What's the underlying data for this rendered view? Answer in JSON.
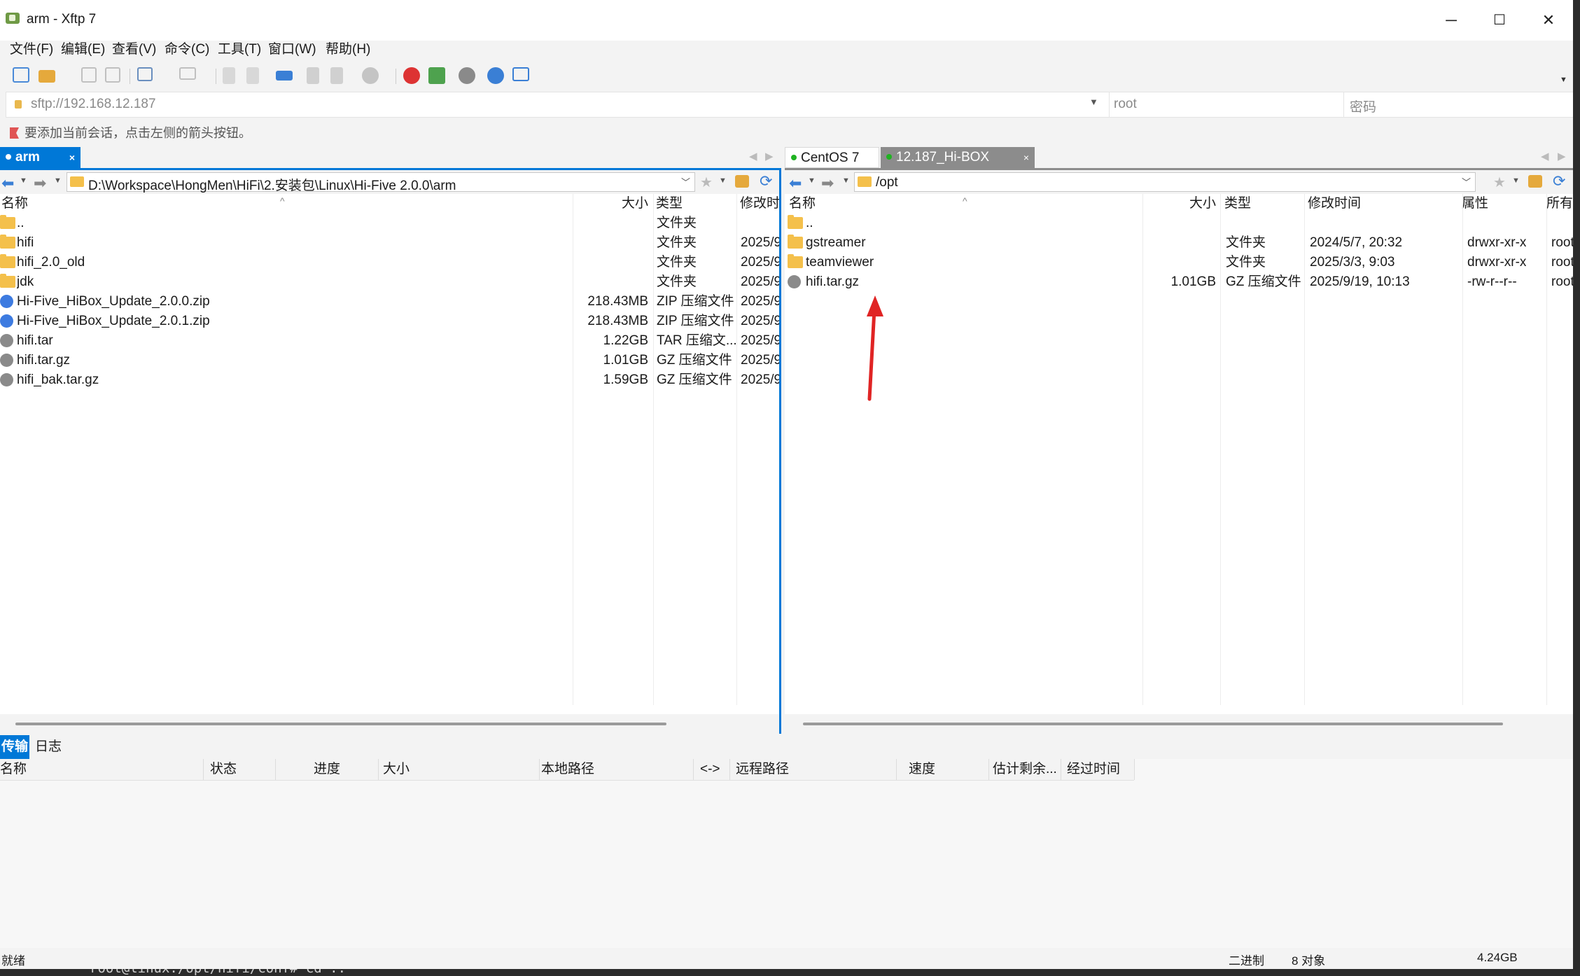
{
  "window": {
    "title": "arm - Xftp 7",
    "minimize": "─",
    "maximize": "☐",
    "close": "✕"
  },
  "menu": [
    "文件(F)",
    "编辑(E)",
    "查看(V)",
    "命令(C)",
    "工具(T)",
    "窗口(W)",
    "帮助(H)"
  ],
  "address": {
    "url": "sftp://192.168.12.187",
    "user_placeholder": "root",
    "password_placeholder": "密码"
  },
  "hint": "要添加当前会话，点击左侧的箭头按钮。",
  "left": {
    "tab": "arm",
    "path": "D:\\Workspace\\HongMen\\HiFi\\2.安装包\\Linux\\Hi-Five 2.0.0\\arm",
    "columns": [
      "名称",
      "大小",
      "类型",
      "修改时"
    ],
    "rows": [
      {
        "name": "..",
        "size": "",
        "type": "文件夹",
        "mtime": ""
      },
      {
        "name": "hifi",
        "size": "",
        "type": "文件夹",
        "mtime": "2025/9"
      },
      {
        "name": "hifi_2.0_old",
        "size": "",
        "type": "文件夹",
        "mtime": "2025/9"
      },
      {
        "name": "jdk",
        "size": "",
        "type": "文件夹",
        "mtime": "2025/9"
      },
      {
        "name": "Hi-Five_HiBox_Update_2.0.0.zip",
        "size": "218.43MB",
        "type": "ZIP 压缩文件",
        "mtime": "2025/9"
      },
      {
        "name": "Hi-Five_HiBox_Update_2.0.1.zip",
        "size": "218.43MB",
        "type": "ZIP 压缩文件",
        "mtime": "2025/9"
      },
      {
        "name": "hifi.tar",
        "size": "1.22GB",
        "type": "TAR 压缩文...",
        "mtime": "2025/9"
      },
      {
        "name": "hifi.tar.gz",
        "size": "1.01GB",
        "type": "GZ 压缩文件",
        "mtime": "2025/9"
      },
      {
        "name": "hifi_bak.tar.gz",
        "size": "1.59GB",
        "type": "GZ 压缩文件",
        "mtime": "2025/9"
      }
    ]
  },
  "right": {
    "tabs": [
      "CentOS 7",
      "12.187_Hi-BOX"
    ],
    "path": "/opt",
    "columns": [
      "名称",
      "大小",
      "类型",
      "修改时间",
      "属性",
      "所有"
    ],
    "rows": [
      {
        "name": "..",
        "size": "",
        "type": "",
        "mtime": "",
        "attr": "",
        "owner": ""
      },
      {
        "name": "gstreamer",
        "size": "",
        "type": "文件夹",
        "mtime": "2024/5/7, 20:32",
        "attr": "drwxr-xr-x",
        "owner": "root"
      },
      {
        "name": "teamviewer",
        "size": "",
        "type": "文件夹",
        "mtime": "2025/3/3, 9:03",
        "attr": "drwxr-xr-x",
        "owner": "root"
      },
      {
        "name": "hifi.tar.gz",
        "size": "1.01GB",
        "type": "GZ 压缩文件",
        "mtime": "2025/9/19, 10:13",
        "attr": "-rw-r--r--",
        "owner": "root"
      }
    ]
  },
  "transfer": {
    "tabs": [
      "传输",
      "日志"
    ],
    "columns": [
      "名称",
      "状态",
      "进度",
      "大小",
      "本地路径",
      "<->",
      "远程路径",
      "速度",
      "估计剩余...",
      "经过时间"
    ]
  },
  "status": {
    "left": "就绪",
    "mode": "二进制",
    "objects": "8 对象",
    "size": "4.24GB"
  },
  "terminal_text": "root@linux:/opt/hifi/conf# cd ..",
  "colors": {
    "accent": "#0078d7",
    "folder": "#f4c04b",
    "arrow": "#e02424"
  }
}
